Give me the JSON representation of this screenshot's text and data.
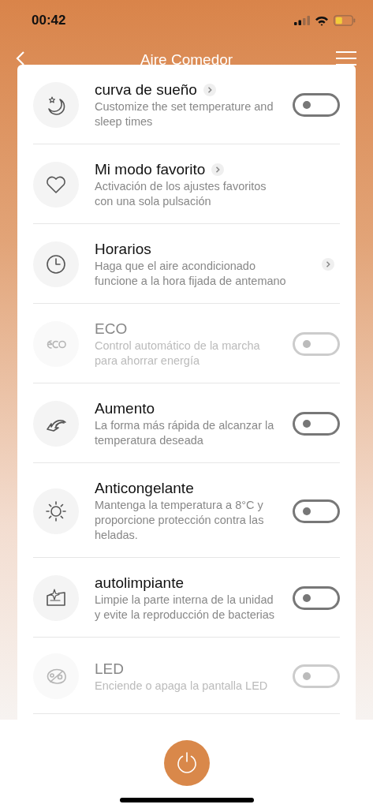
{
  "status_bar": {
    "time": "00:42"
  },
  "header": {
    "title": "Aire Comedor"
  },
  "rows": [
    {
      "title": "curva de sueño",
      "title_link": true,
      "description": "Customize the set temperature and sleep times",
      "kind": "toggle",
      "on": false,
      "disabled": false
    },
    {
      "title": "Mi modo favorito",
      "title_link": true,
      "description": "Activación de los ajustes favoritos con una sola pulsación",
      "kind": "plain",
      "disabled": false
    },
    {
      "title": "Horarios",
      "title_link": false,
      "description": "Haga que el aire acondicionado funcione a la hora fijada de antemano",
      "kind": "link",
      "disabled": false
    },
    {
      "title": "ECO",
      "title_link": false,
      "description": "Control automático de la marcha para ahorrar energía",
      "kind": "toggle",
      "on": false,
      "disabled": true
    },
    {
      "title": "Aumento",
      "title_link": false,
      "description": "La forma más rápida de alcanzar la temperatura deseada",
      "kind": "toggle",
      "on": false,
      "disabled": false
    },
    {
      "title": "Anticongelante",
      "title_link": false,
      "description": "Mantenga la temperatura a 8°C y proporcione protección contra las heladas.",
      "kind": "toggle",
      "on": false,
      "disabled": false
    },
    {
      "title": "autolimpiante",
      "title_link": false,
      "description": "Limpie la parte interna de la unidad y evite la reproducción de bacterias",
      "kind": "toggle",
      "on": false,
      "disabled": false
    },
    {
      "title": "LED",
      "title_link": false,
      "description": "Enciende o apaga la pantalla LED",
      "kind": "toggle",
      "on": false,
      "disabled": true
    }
  ]
}
